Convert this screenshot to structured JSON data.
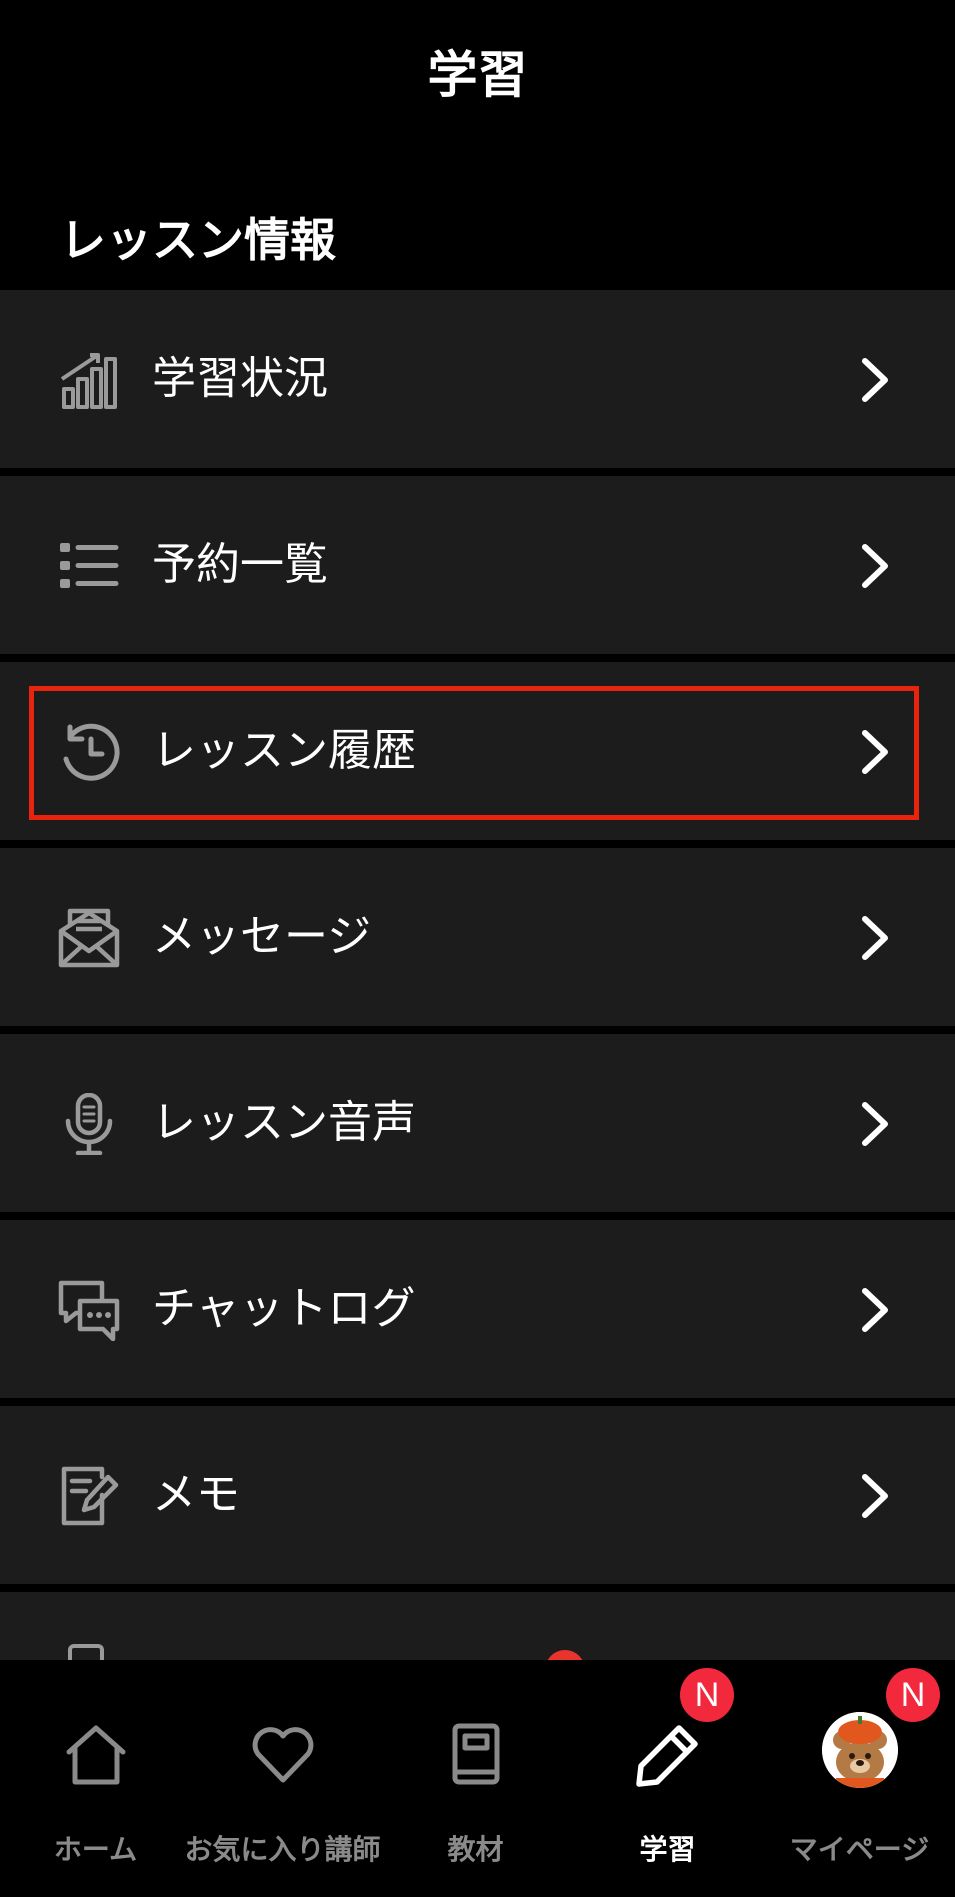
{
  "header": {
    "title": "学習"
  },
  "section": {
    "title": "レッスン情報"
  },
  "menu": {
    "items": [
      {
        "label": "学習状況",
        "icon": "bar-chart-icon"
      },
      {
        "label": "予約一覧",
        "icon": "list-icon"
      },
      {
        "label": "レッスン履歴",
        "icon": "history-icon",
        "highlighted": true
      },
      {
        "label": "メッセージ",
        "icon": "envelope-icon"
      },
      {
        "label": "レッスン音声",
        "icon": "microphone-icon"
      },
      {
        "label": "チャットログ",
        "icon": "chat-icon"
      },
      {
        "label": "メモ",
        "icon": "memo-icon"
      }
    ]
  },
  "bottom_nav": {
    "items": [
      {
        "label": "ホーム",
        "icon": "home-icon"
      },
      {
        "label": "お気に入り講師",
        "icon": "heart-icon"
      },
      {
        "label": "教材",
        "icon": "book-icon"
      },
      {
        "label": "学習",
        "icon": "pencil-icon",
        "active": true,
        "badge": "N"
      },
      {
        "label": "マイページ",
        "icon": "avatar",
        "badge": "N"
      }
    ]
  },
  "colors": {
    "background": "#000000",
    "row": "#1c1c1c",
    "highlight": "#e8230e",
    "badge": "#f2293d",
    "inactive": "#8a8a8a",
    "icon": "#9a9a9a"
  }
}
